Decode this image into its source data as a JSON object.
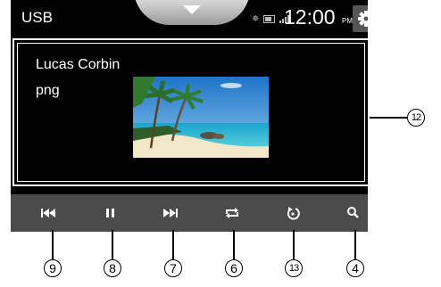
{
  "status_bar": {
    "source": "USB",
    "time": "12:00",
    "ampm": "PM",
    "icons": [
      "bluetooth-icon",
      "battery-icon",
      "signal-icon",
      "gear-icon",
      "chevron-down-icon"
    ]
  },
  "now_playing": {
    "artist": "Lucas Corbin",
    "file_type": "png"
  },
  "controls": [
    "previous-icon",
    "pause-icon",
    "next-icon",
    "repeat-icon",
    "rotate-icon",
    "search-icon"
  ],
  "callouts": {
    "c9": "9",
    "c8": "8",
    "c7": "7",
    "c6": "6",
    "c13": "13",
    "c4": "4",
    "c12": "12"
  }
}
